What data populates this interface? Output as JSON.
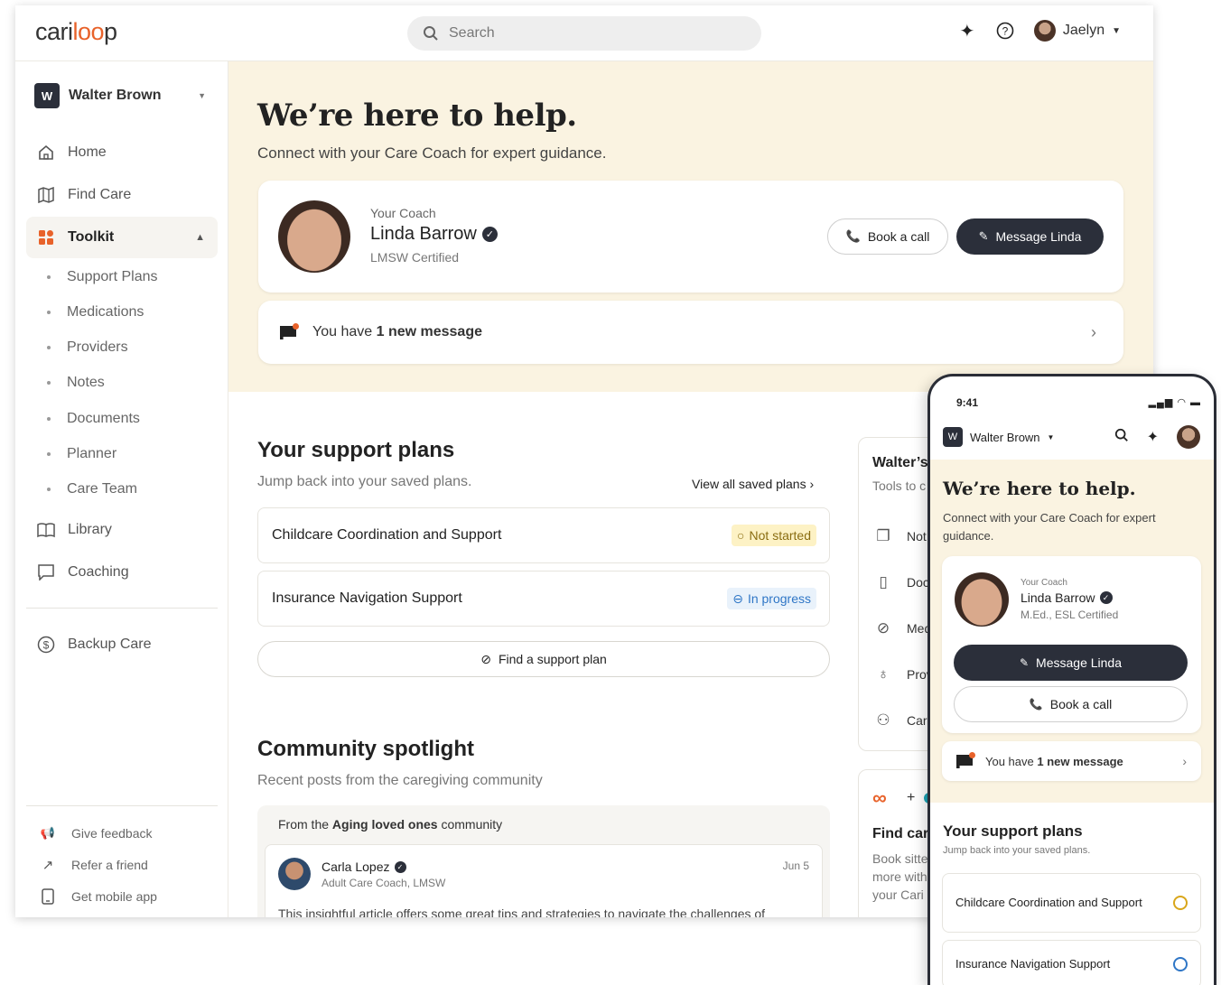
{
  "brand": {
    "logo_left": "cari",
    "logo_oo": "loo",
    "logo_right": "p",
    "accent": "#e8622a",
    "dark": "#2b2f3a",
    "hero_bg": "#faf3e1"
  },
  "topbar": {
    "search_placeholder": "Search",
    "sparkle_icon": "sparkle-icon",
    "help_icon": "help-icon",
    "user_name": "Jaelyn"
  },
  "sidebar": {
    "account_initial": "W",
    "account_name": "Walter Brown",
    "items": [
      {
        "label": "Home",
        "icon": "home-icon"
      },
      {
        "label": "Find Care",
        "icon": "map-icon"
      },
      {
        "label": "Toolkit",
        "icon": "toolkit-icon"
      },
      {
        "label": "Library",
        "icon": "book-icon"
      },
      {
        "label": "Coaching",
        "icon": "chat-icon"
      },
      {
        "label": "Backup Care",
        "icon": "dollar-circle-icon"
      }
    ],
    "toolkit_sub": [
      "Support Plans",
      "Medications",
      "Providers",
      "Notes",
      "Documents",
      "Planner",
      "Care Team"
    ],
    "footer": [
      {
        "label": "Give feedback",
        "icon": "megaphone-icon"
      },
      {
        "label": "Refer a friend",
        "icon": "arrow-up-right-icon"
      },
      {
        "label": "Get mobile app",
        "icon": "phone-icon"
      }
    ]
  },
  "hero": {
    "title": "We’re here to help.",
    "subtitle": "Connect with your Care Coach for expert guidance.",
    "coach_label": "Your Coach",
    "coach_name": "Linda Barrow",
    "coach_cert": "LMSW Certified",
    "book_call": "Book a call",
    "message": "Message Linda",
    "msg_prefix": "You have",
    "msg_count": "1 new message"
  },
  "plans": {
    "title": "Your support plans",
    "subtitle": "Jump back into your saved plans.",
    "view_all": "View all saved plans",
    "items": [
      {
        "name": "Childcare Coordination and Support",
        "status": "Not started"
      },
      {
        "name": "Insurance Navigation Support",
        "status": "In progress"
      }
    ],
    "find": "Find a support plan"
  },
  "community": {
    "title": "Community spotlight",
    "subtitle": "Recent posts from the caregiving community",
    "from_prefix": "From the",
    "from_name": "Aging loved ones",
    "from_suffix": "community",
    "post_author": "Carla Lopez",
    "post_role": "Adult Care Coach, LMSW",
    "post_date": "Jun 5",
    "post_text": "This insightful article offers some great tips and strategies to navigate the challenges of"
  },
  "tools": {
    "title": "Walter’s",
    "subtitle": "Tools to c",
    "rows": [
      {
        "label": "Not",
        "icon": "notes-icon"
      },
      {
        "label": "Doc",
        "icon": "document-icon"
      },
      {
        "label": "Med",
        "icon": "pill-icon"
      },
      {
        "label": "Prov",
        "icon": "stethoscope-icon"
      },
      {
        "label": "Care",
        "icon": "team-icon"
      }
    ]
  },
  "backup": {
    "title": "Find car",
    "desc_1": "Book sitte",
    "desc_2": "more with",
    "desc_3": "your Cari"
  },
  "phone": {
    "time": "9:41",
    "account_initial": "W",
    "account_name": "Walter Brown",
    "title": "We’re here to help.",
    "subtitle": "Connect with your Care Coach for expert guidance.",
    "coach_label": "Your Coach",
    "coach_name": "Linda Barrow",
    "coach_cert": "M.Ed., ESL Certified",
    "message": "Message Linda",
    "book_call": "Book a call",
    "msg_prefix": "You have",
    "msg_count": "1 new message",
    "plans_title": "Your support plans",
    "plans_sub": "Jump back into your saved plans.",
    "plan_1": "Childcare Coordination and Support",
    "plan_2": "Insurance Navigation Support"
  }
}
